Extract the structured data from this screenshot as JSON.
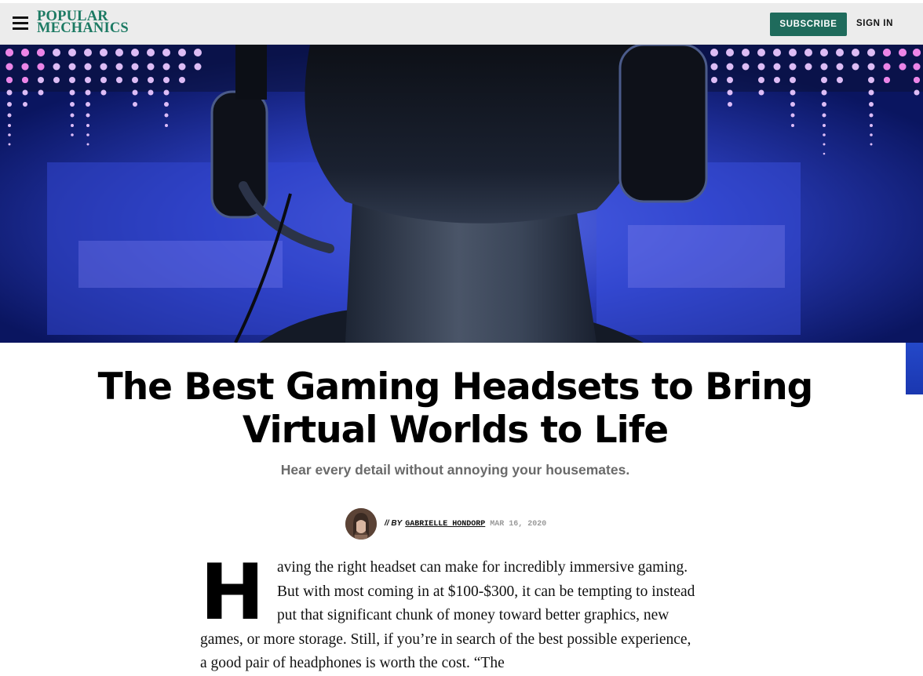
{
  "header": {
    "logo_line1": "POPULAR",
    "logo_line2": "MECHANICS",
    "subscribe_label": "SUBSCRIBE",
    "signin_label": "SIGN IN",
    "brand_color": "#1c7a63",
    "button_color": "#1f6b5c"
  },
  "hero": {
    "icon": "hero-image"
  },
  "article": {
    "title": "The Best Gaming Headsets to Bring Virtual Worlds to Life",
    "dek": "Hear every detail without annoying your housemates.",
    "byline_prefix": "// BY",
    "author": "GABRIELLE HONDORP",
    "date": "MAR 16, 2020",
    "dropcap": "H",
    "body": "aving the right headset can make for incredibly immersive gaming. But with most coming in at $100-$300, it can be tempting to instead put that significant chunk of money toward better graphics, new games, or more storage. Still, if you’re in search of the best possible experience, a good pair of headphones is worth the cost. “The"
  }
}
